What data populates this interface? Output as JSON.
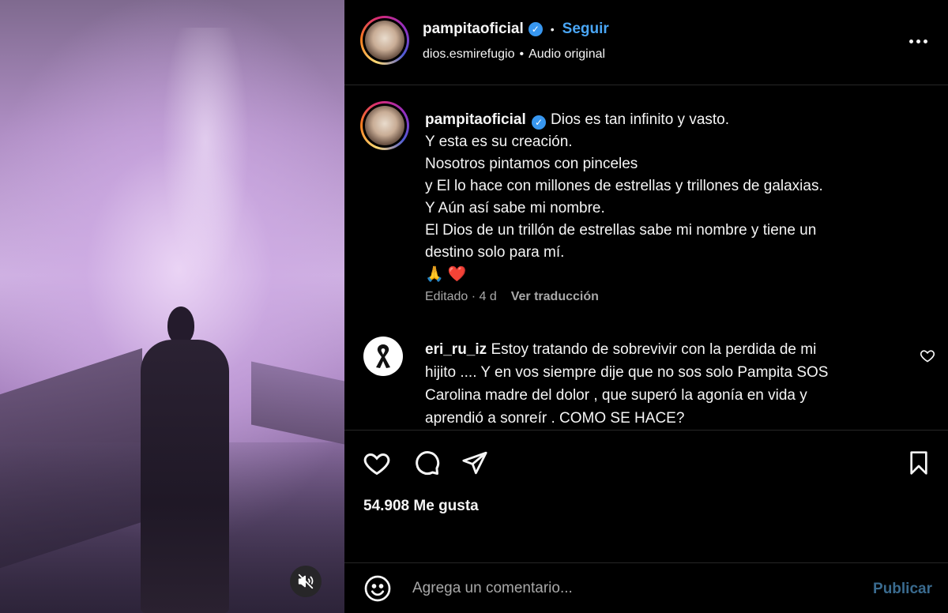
{
  "header": {
    "username": "pampitaoficial",
    "follow_label": "Seguir",
    "audio_account": "dios.esmirefugio",
    "audio_label": "Audio original"
  },
  "caption": {
    "username": "pampitaoficial",
    "lines": [
      "Dios es tan infinito y vasto.",
      "Y esta es su creación.",
      "Nosotros pintamos con pinceles",
      "y El lo hace con millones de estrellas y trillones de galaxias.",
      "Y Aún así sabe mi nombre.",
      "El Dios de un trillón de estrellas sabe mi nombre y tiene un",
      "destino solo para mí."
    ],
    "emojis": "🙏 ❤️",
    "edited_label": "Editado · 4 d",
    "translate_label": "Ver traducción"
  },
  "comment": {
    "username": "eri_ru_iz",
    "text_line1": "Estoy tratando de sobrevivir con la perdida de mi",
    "text_line2": "hijito .... Y en vos siempre dije que no sos solo Pampita SOS",
    "text_line3": "Carolina madre del dolor , que superó la agonía en vida y",
    "text_line4": "aprendió a sonreír . COMO SE HACE?"
  },
  "likes": {
    "text": "54.908 Me gusta"
  },
  "add_comment": {
    "placeholder": "Agrega un comentario...",
    "publish_label": "Publicar"
  },
  "colors": {
    "accent": "#4aa6f5",
    "verified": "#3897f0",
    "publish_disabled": "#3a6b8f",
    "muted_text": "#a8a8a8"
  },
  "icons": {
    "verified": "verified-badge-icon",
    "more": "more-options-icon",
    "like": "heart-icon",
    "comment": "comment-icon",
    "share": "send-icon",
    "save": "bookmark-icon",
    "mute": "muted-speaker-icon",
    "emoji": "emoji-icon",
    "mourning": "mourning-ribbon-icon"
  }
}
